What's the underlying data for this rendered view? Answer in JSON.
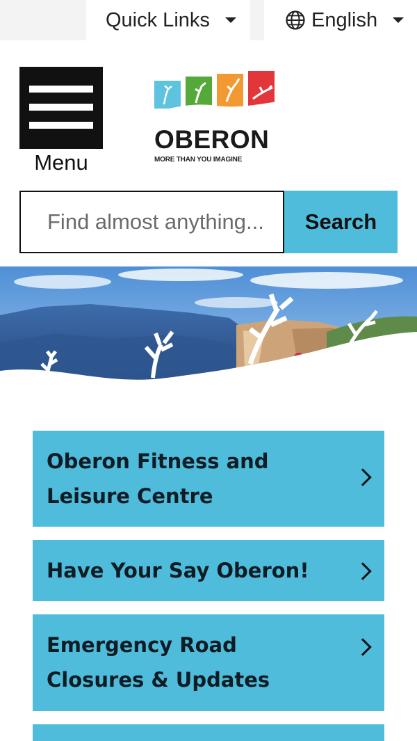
{
  "top_bar": {
    "quick_links_label": "Quick Links",
    "language_label": "English",
    "language_icon": "globe-icon"
  },
  "header": {
    "menu_label": "Menu",
    "logo": {
      "name": "OBERON",
      "tagline": "MORE THAN YOU IMAGINE",
      "tile_colors": [
        "#5ec3de",
        "#55a83a",
        "#f29a31",
        "#e2363a"
      ]
    }
  },
  "search": {
    "placeholder": "Find almost anything...",
    "button_label": "Search"
  },
  "quick_cards": [
    {
      "label": "Oberon Fitness and Leisure Centre"
    },
    {
      "label": "Have Your Say Oberon!"
    },
    {
      "label": "Emergency Road Closures & Updates"
    },
    {
      "label": ""
    }
  ],
  "colors": {
    "accent": "#4fbcdb",
    "menu_bg": "#111111"
  }
}
